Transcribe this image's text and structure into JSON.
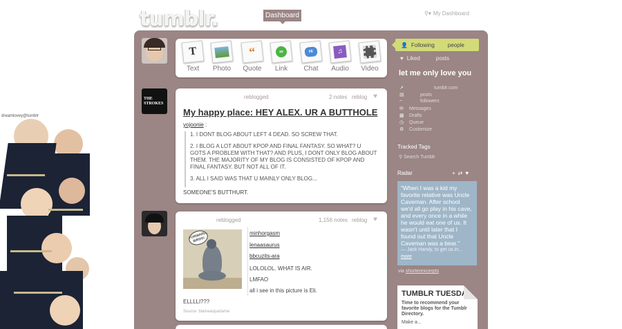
{
  "header": {
    "logo": "tumblr.",
    "dashboard_tab": "Dashboard",
    "my_dashboard": "My Dashboard"
  },
  "background": {
    "watermark": "dreamlovey@tumblr"
  },
  "post_types": [
    {
      "label": "Text",
      "icon": "text-icon"
    },
    {
      "label": "Photo",
      "icon": "photo-icon"
    },
    {
      "label": "Quote",
      "icon": "quote-icon"
    },
    {
      "label": "Link",
      "icon": "link-icon"
    },
    {
      "label": "Chat",
      "icon": "chat-icon"
    },
    {
      "label": "Audio",
      "icon": "audio-icon"
    },
    {
      "label": "Video",
      "icon": "video-icon"
    }
  ],
  "posts": [
    {
      "avatar_text": "THE STROKES",
      "reblogged": "reblogged",
      "notes": "2 notes",
      "reblog": "reblog",
      "title": "My happy place: HEY ALEX. UR A BUTTHOLE",
      "user": "yojoonie",
      "quotes": [
        "1. I DONT BLOG ABOUT LEFT 4 DEAD. SO SCREW THAT.",
        "2. I BLOG A LOT ABOUT KPOP AND FINAL FANTASY. SO WHAT? U GOTS A PROBLEM WITH THAT? AND PLUS, I DONT ONLY BLOG ABOUT THEM. THE MAJORITY OF MY BLOG IS CONSISTED OF KPOP AND FINAL FANTASY. BUT NOT ALL OF IT.",
        "3. ALL I SAID WAS THAT U MAINLY ONLY BLOG..."
      ],
      "tail": "SOMEONE'S BUTTHURT."
    },
    {
      "reblogged": "reblogged",
      "notes": "1,156 notes",
      "reblog": "reblog",
      "photo_sign": "FORWARD, BIRDS!",
      "users": [
        "minhorgasm",
        "lenaasaurus",
        "bbcuzits-ara"
      ],
      "lines": [
        "LOLOLOL. WHAT IS AIR.",
        "LMFAO",
        "all i see in this picture is Eli."
      ],
      "tail": "ELLLLl???",
      "source": "Source: blameaspartame"
    }
  ],
  "sidebar": {
    "following": "Following",
    "following_count_label": "people",
    "liked": "Liked",
    "liked_posts_label": "posts",
    "blog_title": "let me only love you",
    "blog_links": [
      {
        "icon": "arrow-icon",
        "label": "tumblr.com"
      },
      {
        "icon": "page-icon",
        "label": "posts"
      },
      {
        "icon": "wave-icon",
        "label": "followers"
      },
      {
        "icon": "mail-icon",
        "label": "Messages"
      },
      {
        "icon": "drafts-icon",
        "label": "Drafts"
      },
      {
        "icon": "clock-icon",
        "label": "Queue"
      },
      {
        "icon": "gear-icon",
        "label": "Customize"
      }
    ],
    "tracked_tags": "Tracked Tags",
    "search_tumblr": "Search Tumblr",
    "radar": "Radar",
    "radar_quote": "\"When I was a kid my favorite relative was Uncle Caveman. After school we'd all go play in his cave, and every once in a while he would eat one of us. It wasn't until later that I found out that Uncle Caveman was a bear.\"",
    "radar_attr": "— Jack Handy, to get us in...",
    "radar_more": "more",
    "via": "via",
    "via_user": "shorterexcerpts",
    "tuesday_title": "TUMBLR TUESDAY",
    "tuesday_text": "Time to recommend your favorite blogs for the Tumblr Directory.",
    "tuesday_more": "Make a..."
  },
  "colors": {
    "container": "#9b8585",
    "follow_highlight": "#d2db77",
    "radar_card": "#9eb6c8"
  }
}
